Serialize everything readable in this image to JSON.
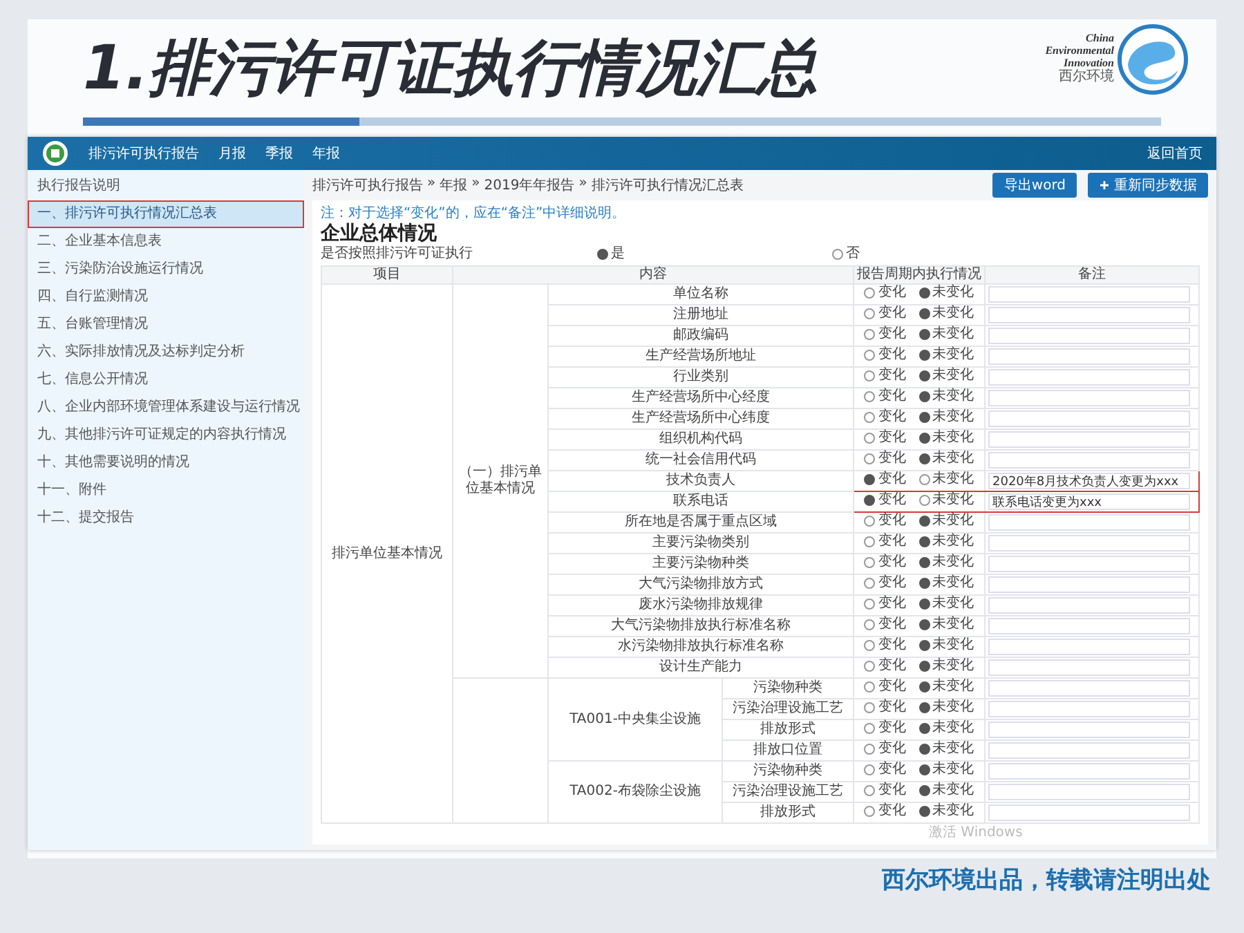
{
  "slide": {
    "title": "1.排污许可证执行情况汇总",
    "logo_lines": [
      "China",
      "Environmental",
      "Innovation"
    ],
    "logo_cn": "西尔环境",
    "footer": "西尔环境出品，转载请注明出处"
  },
  "app": {
    "header": {
      "title": "排污许可执行报告",
      "nav": [
        "月报",
        "季报",
        "年报"
      ],
      "home_link": "返回首页"
    },
    "sidebar": [
      {
        "label": "执行报告说明",
        "selected": false
      },
      {
        "label": "一、排污许可执行情况汇总表",
        "selected": true
      },
      {
        "label": "二、企业基本信息表",
        "selected": false
      },
      {
        "label": "三、污染防治设施运行情况",
        "selected": false
      },
      {
        "label": "四、自行监测情况",
        "selected": false
      },
      {
        "label": "五、台账管理情况",
        "selected": false
      },
      {
        "label": "六、实际排放情况及达标判定分析",
        "selected": false
      },
      {
        "label": "七、信息公开情况",
        "selected": false
      },
      {
        "label": "八、企业内部环境管理体系建设与运行情况",
        "selected": false
      },
      {
        "label": "九、其他排污许可证规定的内容执行情况",
        "selected": false
      },
      {
        "label": "十、其他需要说明的情况",
        "selected": false
      },
      {
        "label": "十一、附件",
        "selected": false
      },
      {
        "label": "十二、提交报告",
        "selected": false
      }
    ],
    "breadcrumb": [
      "排污许可执行报告",
      "年报",
      "2019年年报告",
      "排污许可执行情况汇总表"
    ],
    "breadcrumb_separator": "»",
    "buttons": [
      "导出word",
      "重新同步数据"
    ],
    "note": "注：对于选择“变化”的，应在“备注”中详细说明。",
    "section_title": "企业总体情况",
    "compliance": {
      "label": "是否按照排污许可证执行",
      "options": [
        {
          "label": "是",
          "selected": true
        },
        {
          "label": "否",
          "selected": false
        }
      ]
    },
    "table": {
      "columns": [
        "项目",
        "内容",
        "报告周期内执行情况",
        "备注"
      ],
      "item": "排污单位基本情况",
      "group": {
        "label": "（一）排污单位基本情况",
        "rows": [
          {
            "content": "单位名称",
            "change": "变化",
            "no_change": "未变化",
            "changed": false
          },
          {
            "content": "注册地址",
            "change": "变化",
            "no_change": "未变化",
            "changed": false
          },
          {
            "content": "邮政编码",
            "change": "变化",
            "no_change": "未变化",
            "changed": false
          },
          {
            "content": "生产经营场所地址",
            "change": "变化",
            "no_change": "未变化",
            "changed": false
          },
          {
            "content": "行业类别",
            "change": "变化",
            "no_change": "未变化",
            "changed": false
          },
          {
            "content": "生产经营场所中心经度",
            "change": "变化",
            "no_change": "未变化",
            "changed": false
          },
          {
            "content": "生产经营场所中心纬度",
            "change": "变化",
            "no_change": "未变化",
            "changed": false
          },
          {
            "content": "组织机构代码",
            "change": "变化",
            "no_change": "未变化",
            "changed": false
          },
          {
            "content": "统一社会信用代码",
            "change": "变化",
            "no_change": "未变化",
            "changed": false
          },
          {
            "content": "技术负责人",
            "change": "变化",
            "no_change": "未变化",
            "changed": true,
            "remark": "2020年8月技术负责人变更为xxx"
          },
          {
            "content": "联系电话",
            "change": "变化",
            "no_change": "未变化",
            "changed": true,
            "remark": "联系电话变更为xxx"
          },
          {
            "content": "所在地是否属于重点区域",
            "change": "变化",
            "no_change": "未变化",
            "changed": false
          },
          {
            "content": "主要污染物类别",
            "change": "变化",
            "no_change": "未变化",
            "changed": false
          },
          {
            "content": "主要污染物种类",
            "change": "变化",
            "no_change": "未变化",
            "changed": false
          },
          {
            "content": "大气污染物排放方式",
            "change": "变化",
            "no_change": "未变化",
            "changed": false
          },
          {
            "content": "废水污染物排放规律",
            "change": "变化",
            "no_change": "未变化",
            "changed": false
          },
          {
            "content": "大气污染物排放执行标准名称",
            "change": "变化",
            "no_change": "未变化",
            "changed": false
          },
          {
            "content": "水污染物排放执行标准名称",
            "change": "变化",
            "no_change": "未变化",
            "changed": false
          },
          {
            "content": "设计生产能力",
            "change": "变化",
            "no_change": "未变化",
            "changed": false
          }
        ]
      },
      "facilities": [
        {
          "name": "TA001-中央集尘设施",
          "rows": [
            {
              "content": "污染物种类",
              "change": "变化",
              "no_change": "未变化",
              "changed": false
            },
            {
              "content": "污染治理设施工艺",
              "change": "变化",
              "no_change": "未变化",
              "changed": false
            },
            {
              "content": "排放形式",
              "change": "变化",
              "no_change": "未变化",
              "changed": false
            },
            {
              "content": "排放口位置",
              "change": "变化",
              "no_change": "未变化",
              "changed": false
            }
          ]
        },
        {
          "name": "TA002-布袋除尘设施",
          "rows": [
            {
              "content": "污染物种类",
              "change": "变化",
              "no_change": "未变化",
              "changed": false
            },
            {
              "content": "污染治理设施工艺",
              "change": "变化",
              "no_change": "未变化",
              "changed": false
            },
            {
              "content": "排放形式",
              "change": "变化",
              "no_change": "未变化",
              "changed": false
            }
          ]
        }
      ]
    },
    "os_watermark": "激活 Windows"
  }
}
